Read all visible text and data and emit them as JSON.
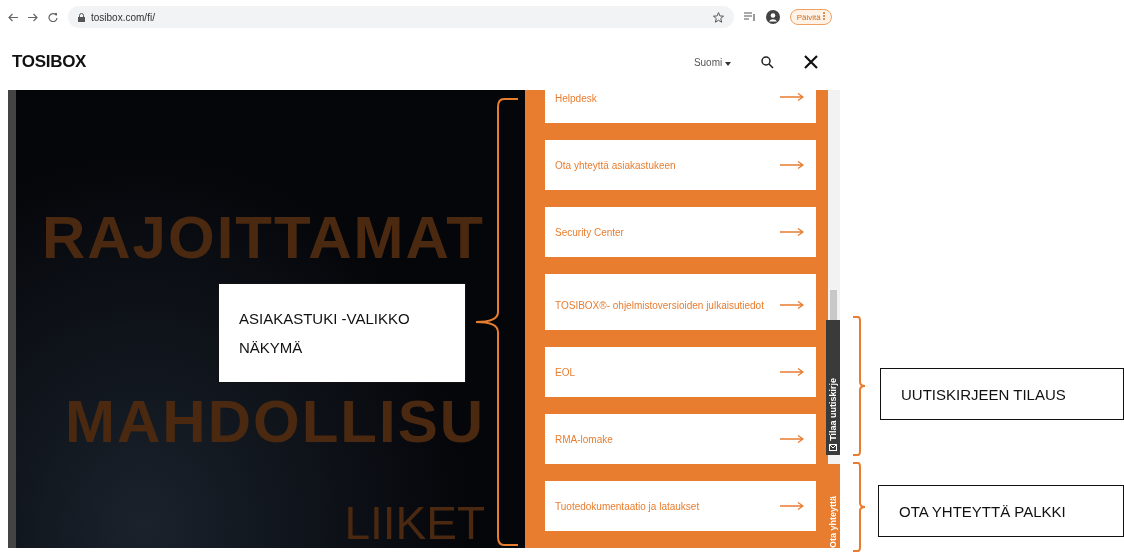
{
  "browser": {
    "url": "tosibox.com/fi/",
    "update_button": "Päivitä"
  },
  "header": {
    "logo": "TOSIBOX",
    "language": "Suomi"
  },
  "hero": {
    "lines": [
      "RAJOITTAMAT",
      "MAHDOLLISU",
      "LIIKET"
    ]
  },
  "support_menu": {
    "items": [
      {
        "label": "Helpdesk"
      },
      {
        "label": "Ota yhteyttä asiakastukeen"
      },
      {
        "label": "Security Center"
      },
      {
        "label": "TOSIBOX®- ohjelmistoversioiden julkaisutiedot"
      },
      {
        "label": "EOL"
      },
      {
        "label": "RMA-lomake"
      },
      {
        "label": "Tuotedokumentaatio ja lataukset"
      }
    ]
  },
  "side_tabs": {
    "newsletter": "Tilaa uutiskirje",
    "contact": "Ota yhteyttä"
  },
  "annotations": [
    {
      "lines": [
        "ASIAKASTUKI  -VALIKKO",
        "NÄKYMÄ"
      ]
    },
    {
      "lines": [
        "UUTISKIRJEEN TILAUS"
      ]
    },
    {
      "lines": [
        "OTA YHTEYTTÄ PALKKI"
      ]
    }
  ]
}
